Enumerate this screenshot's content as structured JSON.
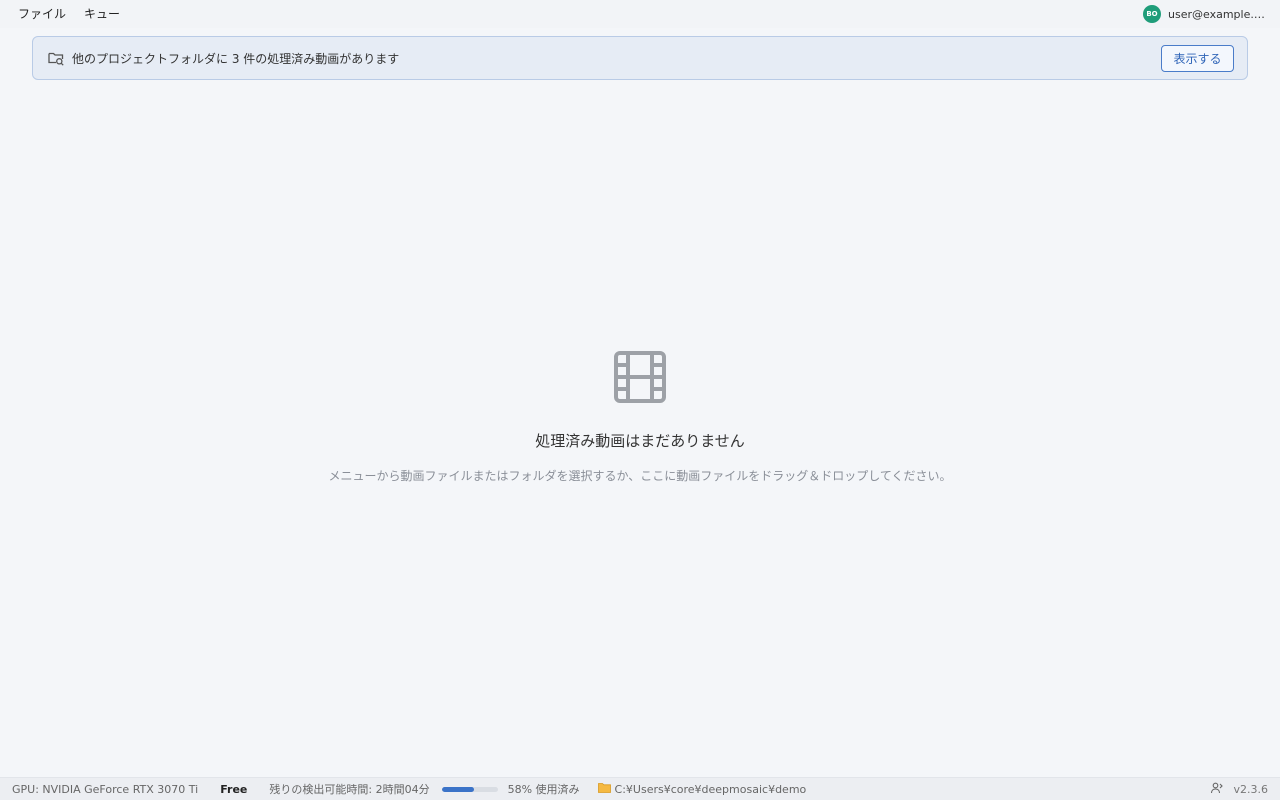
{
  "menubar": {
    "items": [
      "ファイル",
      "キュー"
    ],
    "account": {
      "avatar_text": "BO",
      "email": "user@example.com",
      "avatar_color": "#1f9d7a"
    }
  },
  "banner": {
    "icon": "folder-search-icon",
    "message": "他のプロジェクトフォルダに 3 件の処理済み動画があります",
    "button_label": "表示する"
  },
  "empty_state": {
    "icon": "film-icon",
    "title": "処理済み動画はまだありません",
    "subtitle": "メニューから動画ファイルまたはフォルダを選択するか、ここに動画ファイルをドラッグ＆ドロップしてください。"
  },
  "statusbar": {
    "gpu": "GPU: NVIDIA GeForce RTX 3070 Ti",
    "plan": "Free",
    "remaining": "残りの検出可能時間: 2時間04分",
    "usage_percent": 58,
    "usage_label": "58% 使用済み",
    "folder_path": "C:¥Users¥core¥deepmosaic¥demo",
    "version": "v2.3.6"
  },
  "colors": {
    "accent": "#3b73c8",
    "banner_bg": "#e6ecf5",
    "folder_icon": "#f5b942"
  }
}
